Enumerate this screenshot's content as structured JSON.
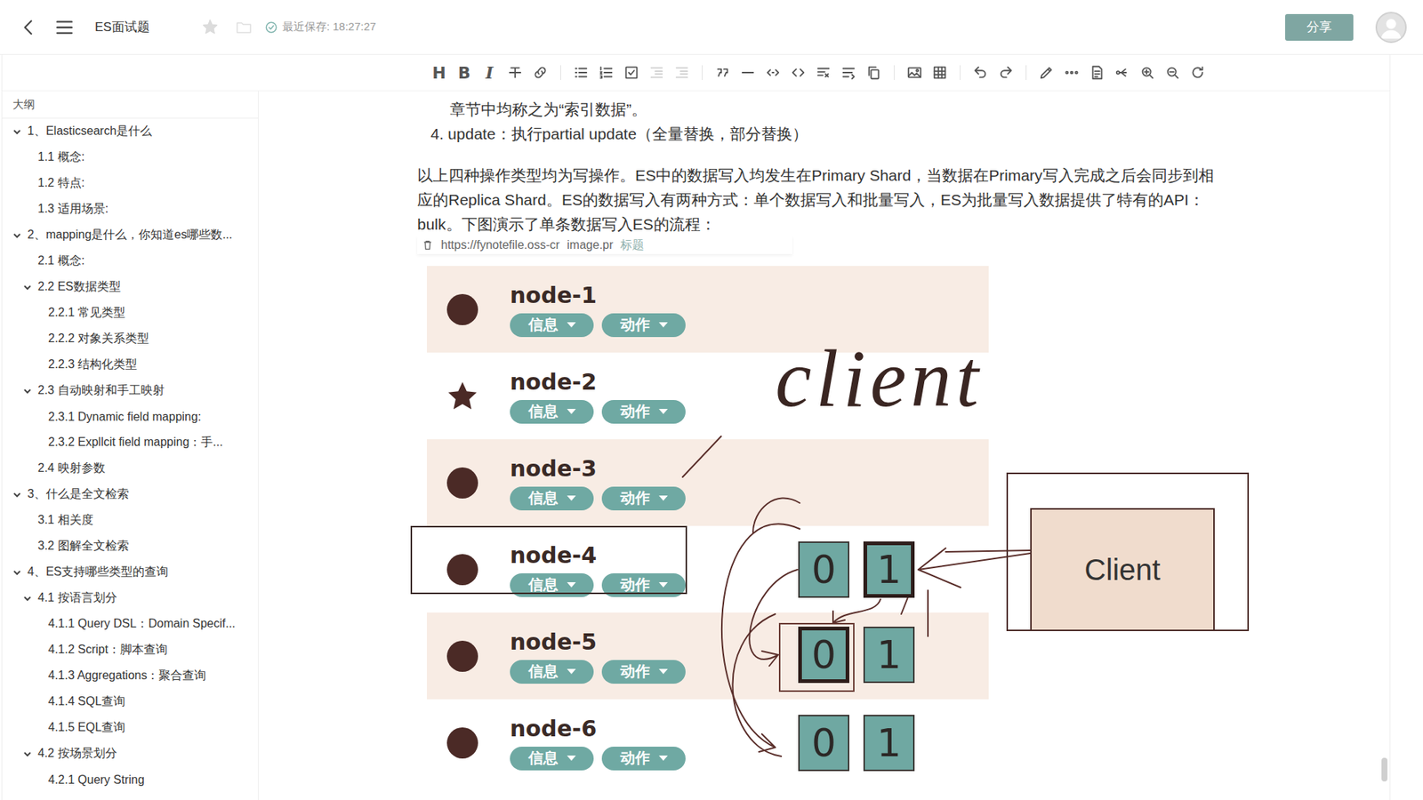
{
  "header": {
    "title": "ES面试题",
    "saved": "最近保存: 18:27:27",
    "share": "分享",
    "starred": false
  },
  "toolbar": [
    {
      "kind": "text",
      "glyph": "H",
      "disabled": false
    },
    {
      "kind": "text",
      "glyph": "B",
      "disabled": false
    },
    {
      "kind": "text",
      "glyph": "I",
      "disabled": false
    },
    {
      "kind": "strike",
      "disabled": false
    },
    {
      "kind": "link",
      "disabled": false
    },
    {
      "kind": "sep",
      "disabled": false
    },
    {
      "kind": "ul",
      "disabled": false
    },
    {
      "kind": "ol",
      "disabled": false
    },
    {
      "kind": "task",
      "disabled": false
    },
    {
      "kind": "outdent",
      "disabled": true
    },
    {
      "kind": "indent",
      "disabled": true
    },
    {
      "kind": "sep",
      "disabled": false
    },
    {
      "kind": "quote",
      "disabled": false
    },
    {
      "kind": "hr",
      "disabled": false
    },
    {
      "kind": "code-inline",
      "disabled": false
    },
    {
      "kind": "code",
      "disabled": false
    },
    {
      "kind": "format",
      "disabled": false
    },
    {
      "kind": "wrap",
      "disabled": false
    },
    {
      "kind": "copy",
      "disabled": false
    },
    {
      "kind": "sep",
      "disabled": false
    },
    {
      "kind": "image",
      "disabled": false
    },
    {
      "kind": "table",
      "disabled": false
    },
    {
      "kind": "sep",
      "disabled": false
    },
    {
      "kind": "undo",
      "disabled": false
    },
    {
      "kind": "redo",
      "disabled": false
    },
    {
      "kind": "sep",
      "disabled": false
    },
    {
      "kind": "pen",
      "disabled": false
    },
    {
      "kind": "more",
      "disabled": false
    },
    {
      "kind": "doc",
      "disabled": false
    },
    {
      "kind": "mindmap",
      "disabled": false
    },
    {
      "kind": "zoom-in",
      "disabled": false
    },
    {
      "kind": "zoom-out",
      "disabled": false
    },
    {
      "kind": "refresh",
      "disabled": false
    }
  ],
  "outline": {
    "title": "大纲",
    "items": [
      {
        "label": "1、Elasticsearch是什么",
        "level": 0,
        "has_children": true,
        "expanded": true
      },
      {
        "label": "1.1 概念:",
        "level": 1,
        "has_children": false,
        "expanded": false
      },
      {
        "label": "1.2 特点:",
        "level": 1,
        "has_children": false,
        "expanded": false
      },
      {
        "label": "1.3 适用场景:",
        "level": 1,
        "has_children": false,
        "expanded": false
      },
      {
        "label": "2、mapping是什么，你知道es哪些数...",
        "level": 0,
        "has_children": true,
        "expanded": true
      },
      {
        "label": "2.1 概念:",
        "level": 1,
        "has_children": false,
        "expanded": false
      },
      {
        "label": "2.2 ES数据类型",
        "level": 1,
        "has_children": true,
        "expanded": true
      },
      {
        "label": "2.2.1 常见类型",
        "level": 2,
        "has_children": false,
        "expanded": false
      },
      {
        "label": "2.2.2 对象关系类型",
        "level": 2,
        "has_children": false,
        "expanded": false
      },
      {
        "label": "2.2.3 结构化类型",
        "level": 2,
        "has_children": false,
        "expanded": false
      },
      {
        "label": "2.3 自动映射和手工映射",
        "level": 1,
        "has_children": true,
        "expanded": true
      },
      {
        "label": "2.3.1 Dynamic field mapping:",
        "level": 2,
        "has_children": false,
        "expanded": false
      },
      {
        "label": "2.3.2 Expllcit field mapping：手...",
        "level": 2,
        "has_children": false,
        "expanded": false
      },
      {
        "label": "2.4 映射参数",
        "level": 1,
        "has_children": false,
        "expanded": false
      },
      {
        "label": "3、什么是全文检索",
        "level": 0,
        "has_children": true,
        "expanded": true
      },
      {
        "label": "3.1 相关度",
        "level": 1,
        "has_children": false,
        "expanded": false
      },
      {
        "label": "3.2 图解全文检索",
        "level": 1,
        "has_children": false,
        "expanded": false
      },
      {
        "label": "4、ES支持哪些类型的查询",
        "level": 0,
        "has_children": true,
        "expanded": true
      },
      {
        "label": "4.1 按语言划分",
        "level": 1,
        "has_children": true,
        "expanded": true
      },
      {
        "label": "4.1.1 Query DSL：Domain Specif...",
        "level": 2,
        "has_children": false,
        "expanded": false
      },
      {
        "label": "4.1.2 Script：脚本查询",
        "level": 2,
        "has_children": false,
        "expanded": false
      },
      {
        "label": "4.1.3 Aggregations：聚合查询",
        "level": 2,
        "has_children": false,
        "expanded": false
      },
      {
        "label": "4.1.4 SQL查询",
        "level": 2,
        "has_children": false,
        "expanded": false
      },
      {
        "label": "4.1.5 EQL查询",
        "level": 2,
        "has_children": false,
        "expanded": false
      },
      {
        "label": "4.2 按场景划分",
        "level": 1,
        "has_children": true,
        "expanded": true
      },
      {
        "label": "4.2.1 Query String",
        "level": 2,
        "has_children": false,
        "expanded": false
      }
    ]
  },
  "document": {
    "lines": [
      {
        "kind": "continuation",
        "text": "章节中均称之为“索引数据”。"
      },
      {
        "kind": "item",
        "text": "4. update：执行partial update（全量替换，部分替换）"
      }
    ],
    "paragraph": "以上四种操作类型均为写操作。ES中的数据写入均发生在Primary Shard，当数据在Primary写入完成之后会同步到相应的Replica Shard。ES的数据写入有两种方式：单个数据写入和批量写入，ES为批量写入数据提供了特有的API： bulk。下图演示了单条数据写入ES的流程：",
    "image_bar": {
      "url": "https://fynotefile.oss-cr",
      "name": "image.pr",
      "caption": "标题"
    },
    "diagram": {
      "nodes": [
        {
          "name": "node-1",
          "master": false,
          "boxed": false,
          "buttons": [
            "信息",
            "动作"
          ]
        },
        {
          "name": "node-2",
          "master": true,
          "boxed": false,
          "buttons": [
            "信息",
            "动作"
          ]
        },
        {
          "name": "node-3",
          "master": false,
          "boxed": false,
          "buttons": [
            "信息",
            "动作"
          ]
        },
        {
          "name": "node-4",
          "master": false,
          "boxed": true,
          "buttons": [
            "信息",
            "动作"
          ]
        },
        {
          "name": "node-5",
          "master": false,
          "boxed": false,
          "buttons": [
            "信息",
            "动作"
          ]
        },
        {
          "name": "node-6",
          "master": false,
          "boxed": false,
          "buttons": [
            "信息",
            "动作"
          ]
        }
      ],
      "shard_rows": [
        [
          {
            "label": "0",
            "primary": false,
            "circled": false
          },
          {
            "label": "1",
            "primary": true,
            "circled": false
          }
        ],
        [
          {
            "label": "0",
            "primary": true,
            "circled": true
          },
          {
            "label": "1",
            "primary": false,
            "circled": false
          }
        ],
        [
          {
            "label": "0",
            "primary": false,
            "circled": false
          },
          {
            "label": "1",
            "primary": false,
            "circled": false
          }
        ]
      ],
      "client": "Client",
      "annotation": "client"
    }
  }
}
